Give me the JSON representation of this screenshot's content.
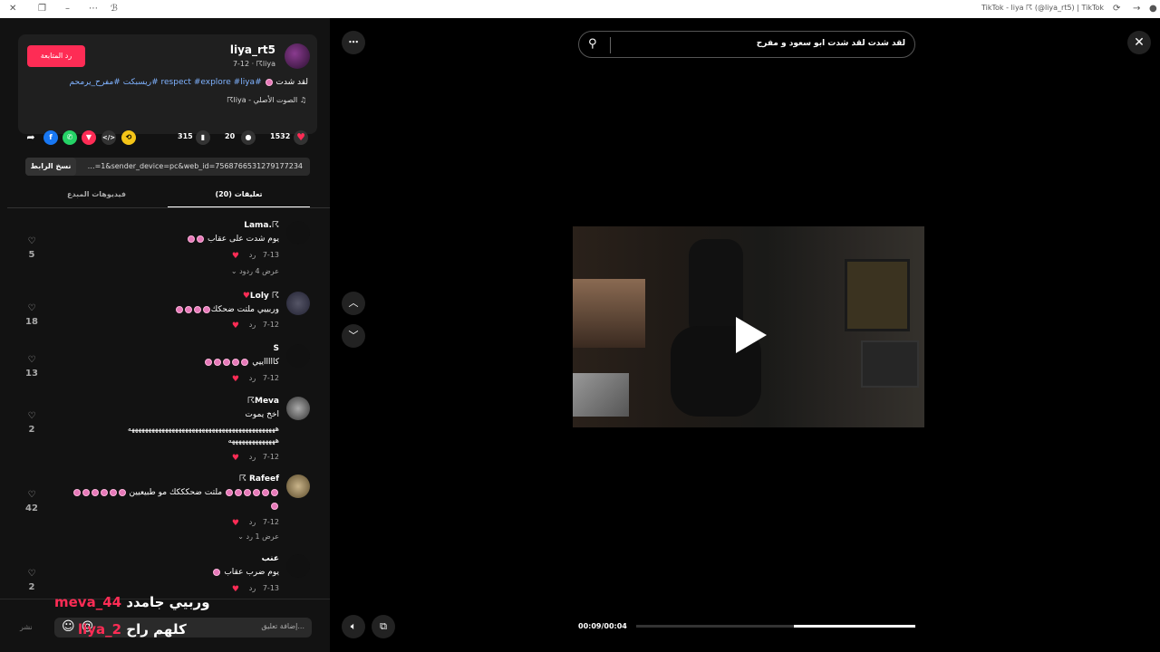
{
  "window": {
    "title": "TikTok - liya ☈ (@liya_rt5) | TikTok"
  },
  "header": {
    "username": "liya_rt5",
    "sub": "7-12 · ☈liya",
    "follow_label": "رد المتابعة",
    "caption_text": "لقد شدت",
    "caption_tags": "#respect #explore #liya #ريسبكت #مفرح_يرمحم",
    "music": "الصوت الأصلي - liya☈"
  },
  "stats": {
    "likes": "1532",
    "comments": "20",
    "saves": "315"
  },
  "link": {
    "url": "…=1&sender_device=pc&web_id=7568766531279177234",
    "copy_label": "نسخ الرابط"
  },
  "tabs": [
    {
      "label": "تعليقات (20)"
    },
    {
      "label": "فيديوهات المبدع"
    }
  ],
  "comments": [
    {
      "name": "Lama.☈",
      "text": "يوم شدت على عقاب",
      "date": "7-13",
      "reply": "رد",
      "likes": "5",
      "replies": "عرض 4 ردود"
    },
    {
      "name": "Loly ☈",
      "text": "وربييي ملتت ضحكك",
      "date": "7-12",
      "reply": "رد",
      "likes": "18"
    },
    {
      "name": "S",
      "text": "كاااااييي",
      "date": "7-12",
      "reply": "رد",
      "likes": "13"
    },
    {
      "name": "☈Meva",
      "text": "اخخ يموت",
      "text2": "ههههههههههههههههههههههههههههههههههههههههههههه",
      "text3": "ههههههههههههههه",
      "date": "7-12",
      "reply": "رد",
      "likes": "2"
    },
    {
      "name": "☈ Rafeef",
      "text": "ملتت ضحكككك مو طبيعيين",
      "date": "7-12",
      "reply": "رد",
      "likes": "42",
      "replies": "عرض 1 رد"
    },
    {
      "name": "عنب",
      "text": "يوم ضرب عقاب",
      "date": "7-13",
      "reply": "رد",
      "likes": "2"
    }
  ],
  "footer": {
    "placeholder": "إضافة تعليق...",
    "post_label": "نشر"
  },
  "overlay": {
    "line1_user": "meva_44",
    "line1_text": "وربيي جامدد",
    "line2_user": "liya_2",
    "line2_text": "كلهم راح"
  },
  "search": {
    "query": "لقد شدت لقد شدت ابو سعود و مفرح"
  },
  "player": {
    "time": "00:09/00:04",
    "progress": 0.43
  }
}
